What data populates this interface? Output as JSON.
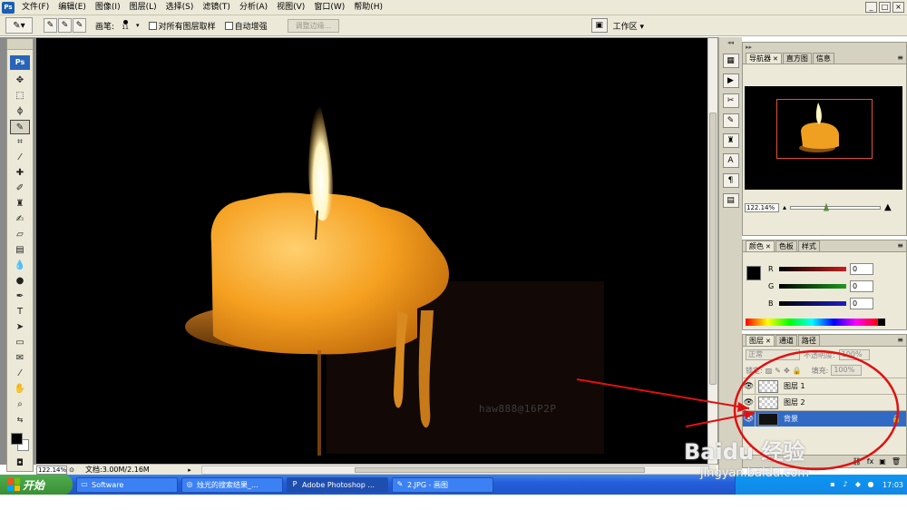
{
  "app": {
    "icon_text": "Ps",
    "logo_text": "Ps"
  },
  "menu": [
    "文件(F)",
    "编辑(E)",
    "图像(I)",
    "图层(L)",
    "选择(S)",
    "滤镜(T)",
    "分析(A)",
    "视图(V)",
    "窗口(W)",
    "帮助(H)"
  ],
  "window_controls": [
    "_",
    "□",
    "×"
  ],
  "options_bar": {
    "brush_label": "画笔:",
    "brush_size": "11",
    "sample_all_layers": "对所有图层取样",
    "auto_enhance": "自动增强",
    "refine_edge": "调整边缘...",
    "workspace": "工作区 ▾"
  },
  "canvas": {
    "watermark": "haw888@16P2P"
  },
  "status": {
    "zoom": "122.14%",
    "doc_size": "文档:3.00M/2.16M"
  },
  "navigator": {
    "tabs": [
      "导航器",
      "直方图",
      "信息"
    ],
    "zoom": "122.14%"
  },
  "color_panel": {
    "tabs": [
      "颜色",
      "色板",
      "样式"
    ],
    "channels": [
      {
        "label": "R",
        "value": "0",
        "color": "#c81e1e"
      },
      {
        "label": "G",
        "value": "0",
        "color": "#1e9a1e"
      },
      {
        "label": "B",
        "value": "0",
        "color": "#1e1ec8"
      }
    ]
  },
  "layers_panel": {
    "tabs": [
      "图层",
      "通道",
      "路径"
    ],
    "blend_mode": "正常",
    "opacity_label": "不透明度:",
    "opacity_value": "100%",
    "lock_label": "锁定:",
    "fill_label": "填充:",
    "fill_value": "100%",
    "layers": [
      {
        "name": "图层 1",
        "selected": false
      },
      {
        "name": "图层 2",
        "selected": false
      },
      {
        "name": "背景",
        "selected": true
      }
    ]
  },
  "taskbar": {
    "start": "开始",
    "tasks": [
      "Software",
      "烛光的搜索结果_...",
      "Adobe Photoshop ...",
      "2.JPG - 画图"
    ],
    "clock": "17:03"
  },
  "baidu": {
    "logo": "Baidu 经验",
    "url": "jingyan.baidu.com"
  },
  "colors": {
    "annotation_red": "#e01010",
    "selection_blue": "#316ac5",
    "candle_orange": "#f5a020"
  }
}
